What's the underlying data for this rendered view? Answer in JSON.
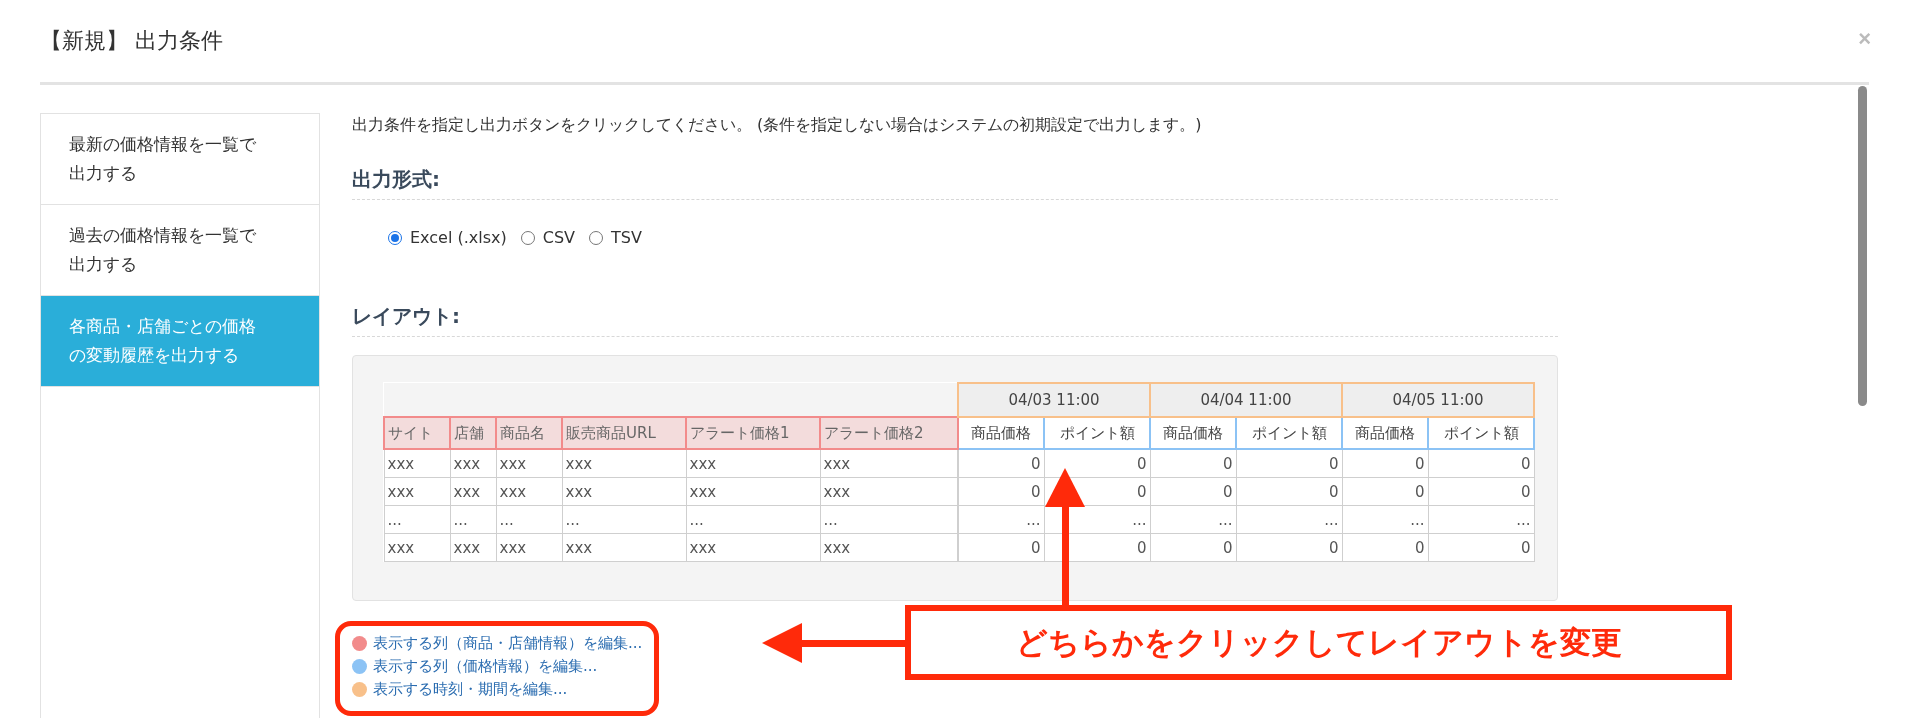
{
  "dialog": {
    "title": "【新規】 出力条件",
    "close": "×"
  },
  "sidebar": {
    "items": [
      {
        "label": "最新の価格情報を一覧で出力する",
        "selected": false
      },
      {
        "label": "過去の価格情報を一覧で出力する",
        "selected": false
      },
      {
        "label": "各商品・店舗ごとの価格の変動履歴を出力する",
        "selected": true
      }
    ]
  },
  "instructions": "出力条件を指定し出力ボタンをクリックしてください。 (条件を指定しない場合はシステムの初期設定で出力します。)",
  "format": {
    "heading": "出力形式:",
    "options": [
      {
        "label": "Excel (.xlsx)",
        "selected": true
      },
      {
        "label": "CSV",
        "selected": false
      },
      {
        "label": "TSV",
        "selected": false
      }
    ]
  },
  "layout": {
    "heading": "レイアウト:",
    "info_columns": [
      "サイト",
      "店舗",
      "商品名",
      "販売商品URL",
      "アラート価格1",
      "アラート価格2"
    ],
    "date_groups": [
      {
        "date": "04/03 11:00",
        "columns": [
          "商品価格",
          "ポイント額"
        ]
      },
      {
        "date": "04/04 11:00",
        "columns": [
          "商品価格",
          "ポイント額"
        ]
      },
      {
        "date": "04/05 11:00",
        "columns": [
          "商品価格",
          "ポイント額"
        ]
      }
    ],
    "rows": [
      {
        "info": [
          "xxx",
          "xxx",
          "xxx",
          "xxx",
          "xxx",
          "xxx"
        ],
        "values": [
          "0",
          "0",
          "0",
          "0",
          "0",
          "0"
        ]
      },
      {
        "info": [
          "xxx",
          "xxx",
          "xxx",
          "xxx",
          "xxx",
          "xxx"
        ],
        "values": [
          "0",
          "0",
          "0",
          "0",
          "0",
          "0"
        ]
      },
      {
        "info": [
          "...",
          "...",
          "...",
          "...",
          "...",
          "..."
        ],
        "values": [
          "...",
          "...",
          "...",
          "...",
          "...",
          "..."
        ]
      },
      {
        "info": [
          "xxx",
          "xxx",
          "xxx",
          "xxx",
          "xxx",
          "xxx"
        ],
        "values": [
          "0",
          "0",
          "0",
          "0",
          "0",
          "0"
        ]
      }
    ]
  },
  "links": [
    {
      "label": "表示する列（商品・店舗情報）を編集...",
      "color": "#f28b8b"
    },
    {
      "label": "表示する列（価格情報）を編集...",
      "color": "#8cc3f5"
    },
    {
      "label": "表示する時刻・期間を編集...",
      "color": "#f8c08a"
    }
  ],
  "annotation": {
    "text": "どちらかをクリックしてレイアウトを変更"
  }
}
